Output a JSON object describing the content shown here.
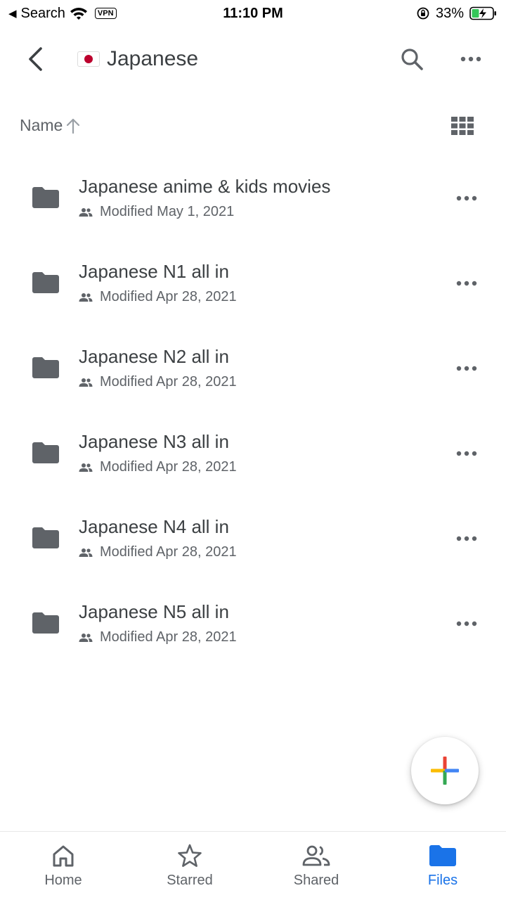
{
  "status_bar": {
    "back_glyph": "◀",
    "back_label": "Search",
    "vpn": "VPN",
    "time": "11:10 PM",
    "battery": "33%"
  },
  "header": {
    "title": "Japanese",
    "back_icon": "back-arrow-icon",
    "search_icon": "search-icon",
    "more_icon": "more-horizontal-icon"
  },
  "sort": {
    "label": "Name",
    "direction": "↑",
    "view_icon": "grid-view-icon"
  },
  "files": [
    {
      "name": "Japanese anime & kids movies",
      "meta": "Modified May 1, 2021"
    },
    {
      "name": "Japanese N1 all in",
      "meta": "Modified Apr 28, 2021"
    },
    {
      "name": "Japanese N2 all in",
      "meta": "Modified Apr 28, 2021"
    },
    {
      "name": "Japanese N3 all in",
      "meta": "Modified Apr 28, 2021"
    },
    {
      "name": "Japanese N4 all in",
      "meta": "Modified Apr 28, 2021"
    },
    {
      "name": "Japanese N5 all in",
      "meta": "Modified Apr 28, 2021"
    }
  ],
  "fab": {
    "icon": "plus-icon"
  },
  "nav": {
    "home": "Home",
    "starred": "Starred",
    "shared": "Shared",
    "files": "Files",
    "active": "files"
  },
  "colors": {
    "accent": "#1a73e8",
    "text": "#3c4043",
    "secondary_text": "#5f6368",
    "folder": "#5f6368",
    "plus_red": "#ea4335",
    "plus_yellow": "#fbbc04",
    "plus_green": "#34a853",
    "plus_blue": "#4285f4"
  }
}
